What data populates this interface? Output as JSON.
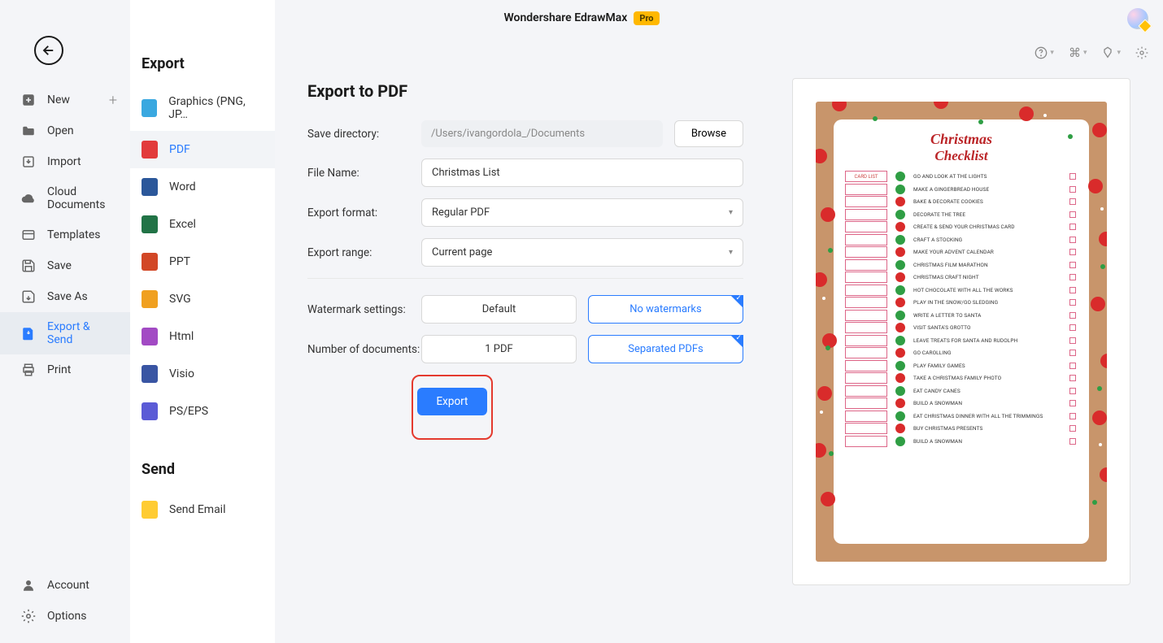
{
  "app": {
    "title": "Wondershare EdrawMax",
    "badge": "Pro"
  },
  "nav": {
    "items": [
      {
        "label": "New",
        "icon": "plus-square",
        "hasPlus": true
      },
      {
        "label": "Open",
        "icon": "folder"
      },
      {
        "label": "Import",
        "icon": "download"
      },
      {
        "label": "Cloud Documents",
        "icon": "cloud"
      },
      {
        "label": "Templates",
        "icon": "templates"
      },
      {
        "label": "Save",
        "icon": "save"
      },
      {
        "label": "Save As",
        "icon": "save-as"
      },
      {
        "label": "Export & Send",
        "icon": "export"
      },
      {
        "label": "Print",
        "icon": "print"
      }
    ],
    "bottom": [
      {
        "label": "Account",
        "icon": "user"
      },
      {
        "label": "Options",
        "icon": "gear"
      }
    ]
  },
  "headings": {
    "export": "Export",
    "send": "Send"
  },
  "export_formats": [
    {
      "label": "Graphics (PNG, JP…",
      "color": "#3aa8e0"
    },
    {
      "label": "PDF",
      "color": "#e23b3b"
    },
    {
      "label": "Word",
      "color": "#2b579a"
    },
    {
      "label": "Excel",
      "color": "#217346"
    },
    {
      "label": "PPT",
      "color": "#d24726"
    },
    {
      "label": "SVG",
      "color": "#f0a020"
    },
    {
      "label": "Html",
      "color": "#a24ac4"
    },
    {
      "label": "Visio",
      "color": "#3955a3"
    },
    {
      "label": "PS/EPS",
      "color": "#5b5bd6"
    }
  ],
  "send_options": [
    {
      "label": "Send Email",
      "color": "#ffcc33"
    }
  ],
  "form": {
    "title": "Export to PDF",
    "labels": {
      "save_directory": "Save directory:",
      "file_name": "File Name:",
      "export_format": "Export format:",
      "export_range": "Export range:",
      "watermark": "Watermark settings:",
      "num_docs": "Number of documents:"
    },
    "values": {
      "directory": "/Users/ivangordola_/Documents",
      "file_name": "Christmas List",
      "format": "Regular PDF",
      "range": "Current page",
      "wm_default": "Default",
      "wm_none": "No watermarks",
      "docs_one": "1 PDF",
      "docs_sep": "Separated PDFs"
    },
    "buttons": {
      "browse": "Browse",
      "export": "Export"
    }
  },
  "preview": {
    "title": "Christmas",
    "subtitle": "Checklist",
    "cardlist_label": "CARD LIST",
    "items": [
      {
        "text": "GO AND LOOK AT THE LIGHTS",
        "ic": "#2f9e44"
      },
      {
        "text": "MAKE A GINGERBREAD HOUSE",
        "ic": "#2f9e44"
      },
      {
        "text": "BAKE & DECORATE COOKIES",
        "ic": "#d92b2b"
      },
      {
        "text": "DECORATE THE TREE",
        "ic": "#2f9e44"
      },
      {
        "text": "CREATE & SEND YOUR CHRISTMAS CARD",
        "ic": "#d92b2b"
      },
      {
        "text": "CRAFT A STOCKING",
        "ic": "#2f9e44"
      },
      {
        "text": "MAKE YOUR ADVENT CALENDAR",
        "ic": "#d92b2b"
      },
      {
        "text": "CHRISTMAS FILM MARATHON",
        "ic": "#2f9e44"
      },
      {
        "text": "CHRISTMAS CRAFT NIGHT",
        "ic": "#d92b2b"
      },
      {
        "text": "HOT CHOCOLATE WITH ALL THE WORKS",
        "ic": "#2f9e44"
      },
      {
        "text": "PLAY IN THE SNOW/GO SLEDGING",
        "ic": "#d92b2b"
      },
      {
        "text": "WRITE A LETTER TO SANTA",
        "ic": "#2f9e44"
      },
      {
        "text": "VISIT SANTA'S GROTTO",
        "ic": "#d92b2b"
      },
      {
        "text": "LEAVE TREATS FOR SANTA AND RUDOLPH",
        "ic": "#2f9e44"
      },
      {
        "text": "GO CAROLLING",
        "ic": "#d92b2b"
      },
      {
        "text": "PLAY FAMILY GAMES",
        "ic": "#2f9e44"
      },
      {
        "text": "TAKE A CHRISTMAS FAMILY PHOTO",
        "ic": "#d92b2b"
      },
      {
        "text": "EAT CANDY CANES",
        "ic": "#2f9e44"
      },
      {
        "text": "BUILD A SNOWMAN",
        "ic": "#d92b2b"
      },
      {
        "text": "EAT CHRISTMAS DINNER WITH ALL THE TRIMMINGS",
        "ic": "#2f9e44"
      },
      {
        "text": "BUY CHRISTMAS PRESENTS",
        "ic": "#d92b2b"
      },
      {
        "text": "BUILD A SNOWMAN",
        "ic": "#2f9e44"
      }
    ]
  }
}
